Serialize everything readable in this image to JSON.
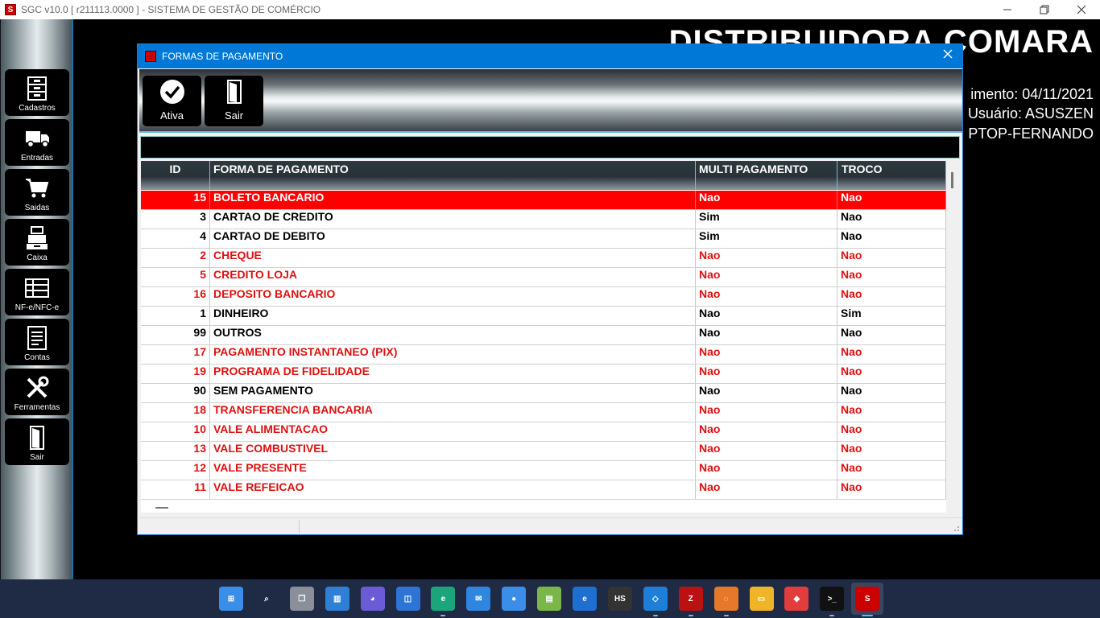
{
  "window": {
    "title": "SGC v10.0 [ r211113.0000 ] - SISTEMA DE GESTÃO DE COMÉRCIO",
    "minimize_icon": "minimize-icon",
    "maximize_icon": "restore-icon",
    "close_icon": "close-icon"
  },
  "sidebar": {
    "items": [
      {
        "label": "Cadastros",
        "icon": "file-cabinet-icon"
      },
      {
        "label": "Entradas",
        "icon": "truck-icon"
      },
      {
        "label": "Saidas",
        "icon": "cart-icon"
      },
      {
        "label": "Caixa",
        "icon": "cash-register-icon"
      },
      {
        "label": "NF-e/NFC-e",
        "icon": "invoice-icon"
      },
      {
        "label": "Contas",
        "icon": "document-icon"
      },
      {
        "label": "Ferramentas",
        "icon": "tools-icon"
      },
      {
        "label": "Sair",
        "icon": "door-icon"
      }
    ]
  },
  "background": {
    "company": "DISTRIBUIDORA COMARA",
    "line1": "imento: 04/11/2021",
    "line2": "Usuário: ASUSZEN",
    "line3": "PTOP-FERNANDO"
  },
  "dialog": {
    "title": "FORMAS DE PAGAMENTO",
    "toolbar": [
      {
        "label": "Ativa",
        "icon": "checkmark-icon"
      },
      {
        "label": "Sair",
        "icon": "door-icon"
      }
    ],
    "filter_value": "",
    "table": {
      "columns": [
        "ID",
        "FORMA DE PAGAMENTO",
        "MULTI PAGAMENTO",
        "TROCO"
      ],
      "rows": [
        {
          "id": "15",
          "forma": "BOLETO BANCARIO",
          "multi": "Nao",
          "troco": "Nao",
          "style": "selected"
        },
        {
          "id": "3",
          "forma": "CARTAO DE CREDITO",
          "multi": "Sim",
          "troco": "Nao",
          "style": "active"
        },
        {
          "id": "4",
          "forma": "CARTAO DE DEBITO",
          "multi": "Sim",
          "troco": "Nao",
          "style": "active"
        },
        {
          "id": "2",
          "forma": "CHEQUE",
          "multi": "Nao",
          "troco": "Nao",
          "style": "inactive"
        },
        {
          "id": "5",
          "forma": "CREDITO LOJA",
          "multi": "Nao",
          "troco": "Nao",
          "style": "inactive"
        },
        {
          "id": "16",
          "forma": "DEPOSITO BANCARIO",
          "multi": "Nao",
          "troco": "Nao",
          "style": "inactive"
        },
        {
          "id": "1",
          "forma": "DINHEIRO",
          "multi": "Nao",
          "troco": "Sim",
          "style": "active"
        },
        {
          "id": "99",
          "forma": "OUTROS",
          "multi": "Nao",
          "troco": "Nao",
          "style": "active"
        },
        {
          "id": "17",
          "forma": "PAGAMENTO INSTANTANEO (PIX)",
          "multi": "Nao",
          "troco": "Nao",
          "style": "inactive"
        },
        {
          "id": "19",
          "forma": "PROGRAMA DE FIDELIDADE",
          "multi": "Nao",
          "troco": "Nao",
          "style": "inactive"
        },
        {
          "id": "90",
          "forma": "SEM PAGAMENTO",
          "multi": "Nao",
          "troco": "Nao",
          "style": "active"
        },
        {
          "id": "18",
          "forma": "TRANSFERENCIA BANCARIA",
          "multi": "Nao",
          "troco": "Nao",
          "style": "inactive"
        },
        {
          "id": "10",
          "forma": "VALE ALIMENTACAO",
          "multi": "Nao",
          "troco": "Nao",
          "style": "inactive"
        },
        {
          "id": "13",
          "forma": "VALE COMBUSTIVEL",
          "multi": "Nao",
          "troco": "Nao",
          "style": "inactive"
        },
        {
          "id": "12",
          "forma": "VALE PRESENTE",
          "multi": "Nao",
          "troco": "Nao",
          "style": "inactive"
        },
        {
          "id": "11",
          "forma": "VALE REFEICAO",
          "multi": "Nao",
          "troco": "Nao",
          "style": "inactive"
        }
      ]
    }
  },
  "colors": {
    "selected_bg": "#ff0000",
    "inactive_text": "#e01010",
    "active_text": "#000000",
    "accent": "#0078d7"
  },
  "taskbar": {
    "icons": [
      "windows-start-icon",
      "search-icon",
      "task-view-icon",
      "widgets-icon",
      "teams-chat-icon",
      "store-icon",
      "edge-icon",
      "mail-icon",
      "meet-icon",
      "notepad-icon",
      "ie-icon",
      "hs-icon",
      "vscode-icon",
      "filezilla-icon",
      "xampp-icon",
      "file-explorer-icon",
      "anydesk-icon",
      "terminal-icon",
      "sgc-app-icon"
    ]
  }
}
